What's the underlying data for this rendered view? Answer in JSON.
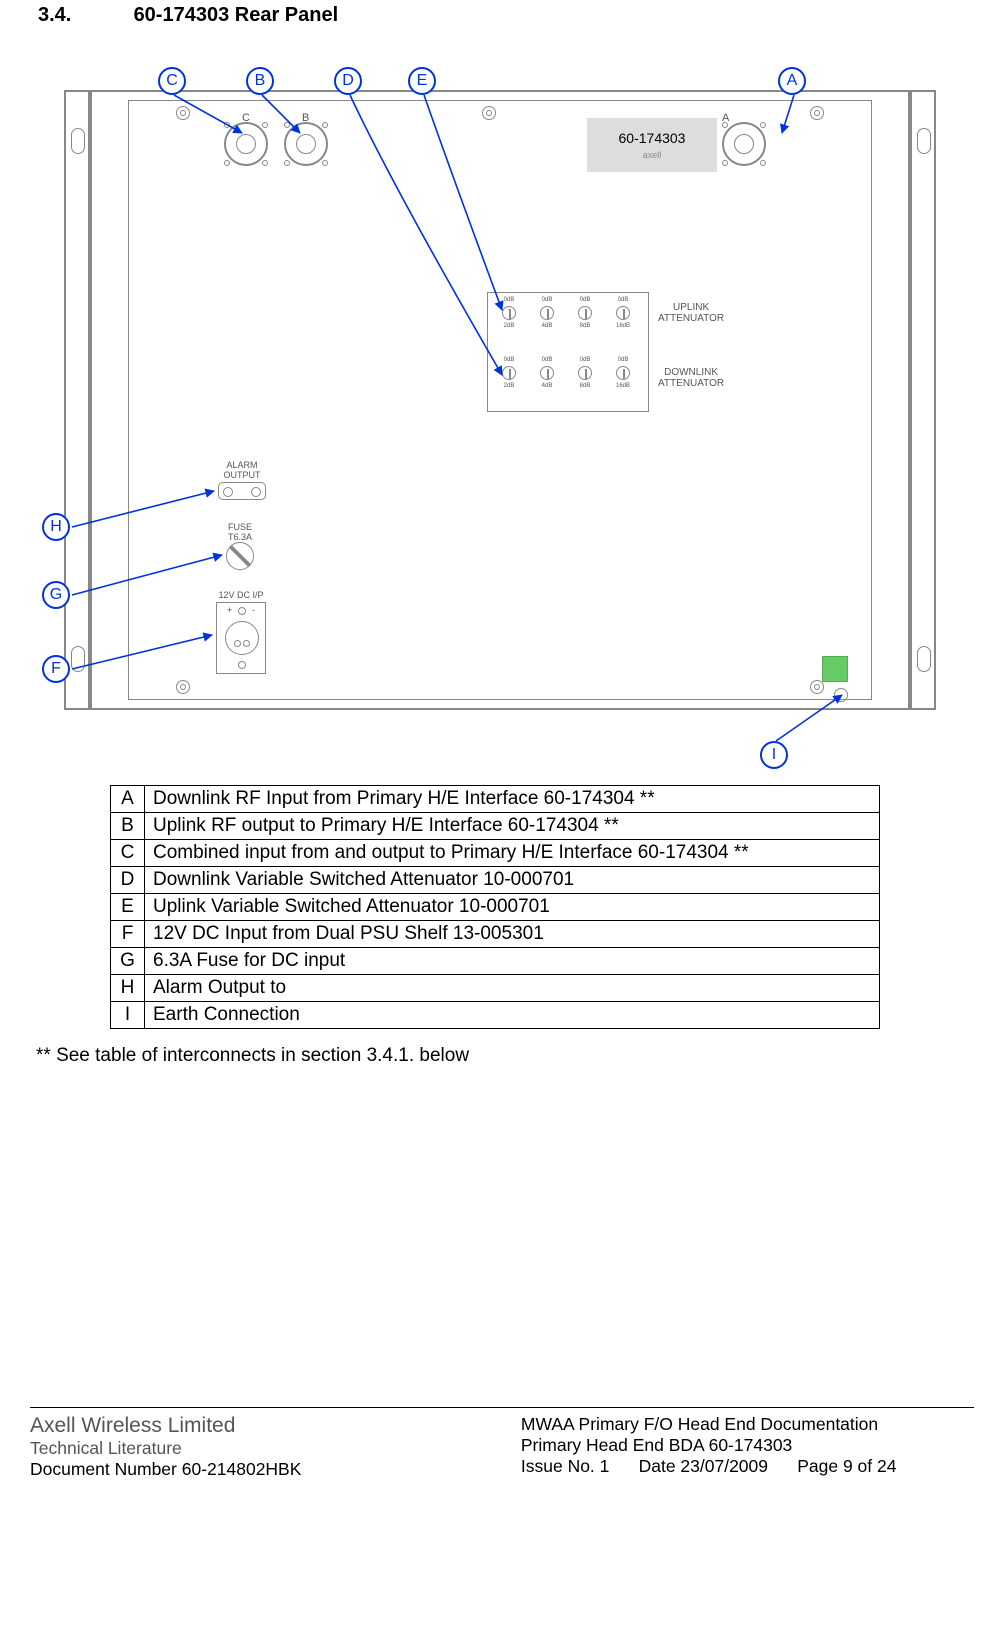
{
  "section": {
    "number": "3.4.",
    "title": "60-174303 Rear Panel"
  },
  "panel": {
    "part_number": "60-174303",
    "brand": "axell",
    "connectors": {
      "C": "C",
      "B": "B",
      "A": "A"
    },
    "attenuators": {
      "uplink_label": "UPLINK\nATTENUATOR",
      "downlink_label": "DOWNLINK\nATTENUATOR",
      "switch_top": [
        "0dB",
        "0dB",
        "0dB",
        "0dB"
      ],
      "switch_bot": [
        "2dB",
        "4dB",
        "8dB",
        "16dB"
      ]
    },
    "alarm_label": "ALARM\nOUTPUT",
    "fuse_label": "FUSE\nT6.3A",
    "dc_label": "12V DC I/P",
    "dc_polarity": {
      "plus": "+",
      "minus": "-"
    }
  },
  "callouts": [
    "A",
    "B",
    "C",
    "D",
    "E",
    "F",
    "G",
    "H",
    "I"
  ],
  "table": [
    {
      "key": "A",
      "desc": "Downlink RF Input from Primary H/E Interface 60-174304 **"
    },
    {
      "key": "B",
      "desc": "Uplink RF output to Primary H/E Interface 60-174304 **"
    },
    {
      "key": "C",
      "desc": "Combined input from and output to Primary H/E Interface 60-174304 **"
    },
    {
      "key": "D",
      "desc": "Downlink Variable Switched Attenuator 10-000701"
    },
    {
      "key": "E",
      "desc": "Uplink Variable Switched Attenuator 10-000701"
    },
    {
      "key": "F",
      "desc": "12V DC Input from Dual PSU Shelf 13-005301"
    },
    {
      "key": "G",
      "desc": "6.3A Fuse for DC input"
    },
    {
      "key": "H",
      "desc": "Alarm Output to"
    },
    {
      "key": "I",
      "desc": "Earth Connection"
    }
  ],
  "footnote": "** See table of interconnects in section 3.4.1. below",
  "footer": {
    "company": "Axell Wireless Limited",
    "tech": "Technical Literature",
    "docnum_label": "Document Number ",
    "docnum": "60-214802HBK",
    "title1": "MWAA Primary F/O Head End Documentation",
    "title2": "Primary Head End BDA 60-174303",
    "issue_label": "Issue No. ",
    "issue": "1",
    "date_label": "Date ",
    "date": "23/07/2009",
    "page_label": "Page ",
    "page": "9 of 24"
  }
}
